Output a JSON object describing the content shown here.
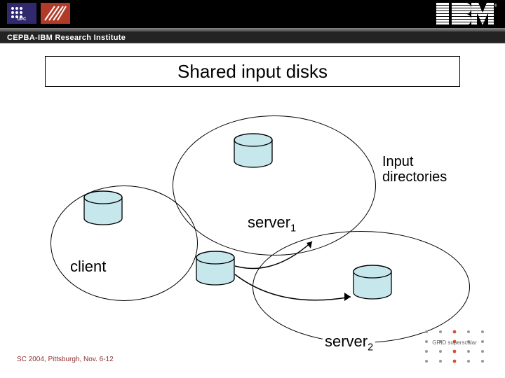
{
  "header": {
    "logo_a_text": "UPC",
    "logo_b_text": "",
    "ibm_bars_color": "#ffffff",
    "ibm_trademark": "®"
  },
  "subheader": {
    "text": "CEPBA-IBM Research Institute"
  },
  "title": "Shared input disks",
  "annotations": {
    "input_dirs_line1": "Input",
    "input_dirs_line2": "directories",
    "server1_base": "server",
    "server1_sub": "1",
    "client": "client",
    "server2_base": "server",
    "server2_sub": "2"
  },
  "cylinder": {
    "fill": "#c6e7ec",
    "stroke": "#000000"
  },
  "footer": "SC 2004, Pittsburgh, Nov. 6-12",
  "grid_logo_text": "GRID superscalar",
  "colors": {
    "accent_red": "#d94f31",
    "logo_a_bg": "#31296e",
    "logo_b_bg": "#b23a28"
  }
}
